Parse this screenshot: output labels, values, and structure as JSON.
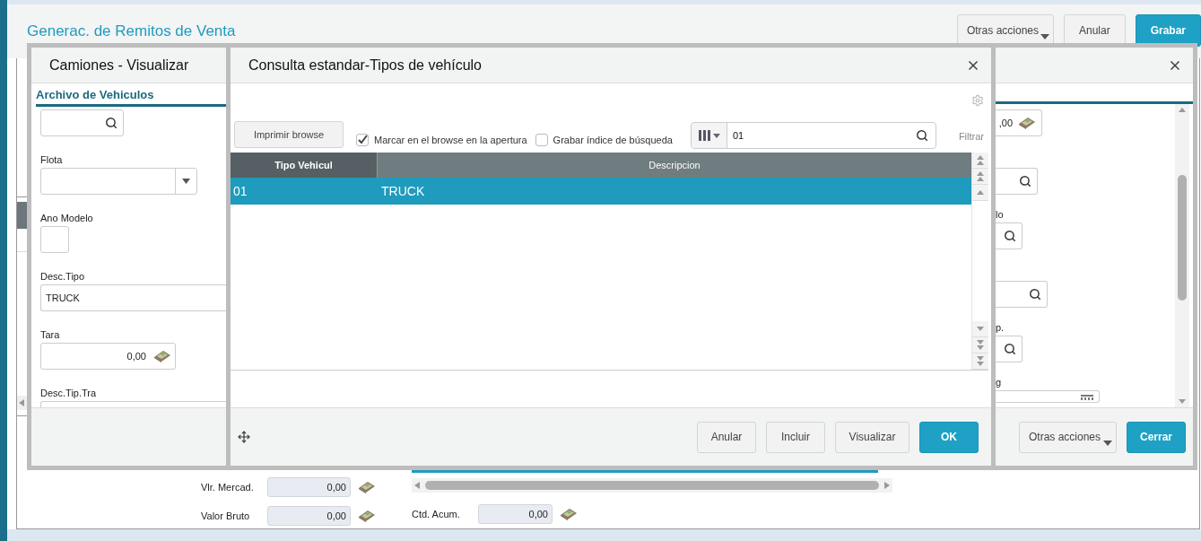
{
  "page": {
    "title": "Generac. de Remitos de Venta",
    "actions": [
      {
        "label": "Otras acciones",
        "kind": "menu"
      },
      {
        "label": "Anular",
        "kind": "default"
      },
      {
        "label": "Grabar",
        "kind": "primary"
      }
    ],
    "totals": [
      {
        "label": "Vlr. Mercad.",
        "value": "0,00"
      },
      {
        "label": "Valor Bruto",
        "value": "0,00"
      }
    ],
    "accum": {
      "label": "Ctd. Acum.",
      "value": "0,00"
    }
  },
  "camiones": {
    "title": "Camiones - Visualizar",
    "section": "Archivo de Vehiculos",
    "fields": [
      {
        "kind": "search"
      },
      {
        "label": "Flota",
        "kind": "select"
      },
      {
        "label": "Ano Modelo",
        "kind": "small"
      },
      {
        "label": "Desc.Tipo",
        "kind": "text",
        "value": "TRUCK"
      },
      {
        "label": "Tara",
        "kind": "money",
        "value": "0,00"
      },
      {
        "label": "Desc.Tip.Tra",
        "kind": "text"
      }
    ],
    "right_fields": [
      {
        "kind": "money",
        "value": ",00"
      },
      {
        "kind": "search"
      },
      {
        "label": "lo",
        "kind": "search"
      },
      {
        "kind": "search"
      },
      {
        "label": "p.",
        "kind": "search"
      },
      {
        "label": "g",
        "kind": "date"
      }
    ],
    "buttons": [
      {
        "label": "Otras acciones",
        "kind": "menu"
      },
      {
        "label": "Cerrar",
        "kind": "primary"
      }
    ]
  },
  "consulta": {
    "title": "Consulta estandar-Tipos de vehículo",
    "print_button": "Imprimir browse",
    "options": [
      {
        "label": "Marcar en el browse en la apertura",
        "checked": true
      },
      {
        "label": "Grabar índice de búsqueda",
        "checked": false
      }
    ],
    "search_value": "01",
    "filter": "Filtrar",
    "columns": [
      "Tipo Vehicul",
      "Descripcion"
    ],
    "rows": [
      {
        "cells": [
          "01",
          "TRUCK"
        ],
        "selected": true
      }
    ],
    "buttons": [
      {
        "label": "Anular",
        "kind": "default"
      },
      {
        "label": "Incluir",
        "kind": "default"
      },
      {
        "label": "Visualizar",
        "kind": "default"
      },
      {
        "label": "OK",
        "kind": "primary"
      }
    ]
  }
}
